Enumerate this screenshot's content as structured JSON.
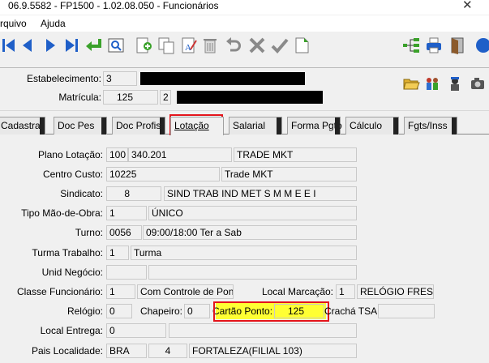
{
  "window": {
    "title": "06.9.5582 - FP1500 - 1.02.08.050 - Funcionários",
    "close_glyph": "✕"
  },
  "menu": {
    "items": [
      "Arquivo",
      "Ajuda"
    ]
  },
  "toolbar": {
    "icons": [
      "first-record-icon",
      "prev-record-icon",
      "next-record-icon",
      "last-record-icon",
      "confirm-return-icon",
      "search-record-icon",
      "new-record-icon",
      "copy-record-icon",
      "edit-record-icon",
      "delete-record-icon",
      "undo-icon",
      "cancel-icon",
      "save-check-icon",
      "note-icon",
      "tree-icon",
      "print-icon",
      "exit-door-icon",
      "help-icon"
    ],
    "colors": {
      "blue": "#1f5fc8",
      "green": "#3aa12a",
      "gray": "#8a8a8a"
    }
  },
  "header": {
    "estabelecimento_label": "Estabelecimento:",
    "estabelecimento_value": "3",
    "matricula_label": "Matrícula:",
    "matricula_value": "125",
    "matricula_digit": "2"
  },
  "tabs": [
    {
      "label": "Cadastral"
    },
    {
      "label": "Doc Pes"
    },
    {
      "label": "Doc Profis"
    },
    {
      "label": "Lotação"
    },
    {
      "label": "Salarial"
    },
    {
      "label": "Forma Pgto"
    },
    {
      "label": "Cálculo"
    },
    {
      "label": "Fgts/Inss"
    }
  ],
  "form": {
    "plano_lotacao": {
      "label": "Plano Lotação:",
      "code": "100",
      "value": "340.201",
      "desc": "TRADE MKT"
    },
    "centro_custo": {
      "label": "Centro Custo:",
      "code": "10225",
      "desc": "Trade MKT"
    },
    "sindicato": {
      "label": "Sindicato:",
      "code": "8",
      "desc": "SIND TRAB IND MET S M M E E I"
    },
    "tipo_mao_obra": {
      "label": "Tipo Mão-de-Obra:",
      "code": "1",
      "desc": "ÚNICO"
    },
    "turno": {
      "label": "Turno:",
      "code": "0056",
      "desc": "09:00/18:00 Ter a Sab"
    },
    "turma_trabalho": {
      "label": "Turma Trabalho:",
      "code": "1",
      "desc": "Turma"
    },
    "unid_negocio": {
      "label": "Unid Negócio:",
      "code": "",
      "desc": ""
    },
    "classe_funcionario": {
      "label": "Classe Funcionário:",
      "code": "1",
      "desc": "Com Controle de Ponto"
    },
    "local_marcacao": {
      "label": "Local Marcação:",
      "code": "1",
      "desc": "RELÓGIO FRESNI"
    },
    "relogio": {
      "label": "Relógio:",
      "value": "0"
    },
    "chapeiro": {
      "label": "Chapeiro:",
      "value": "0"
    },
    "cartao_ponto": {
      "label": "Cartão Ponto:",
      "value": "125"
    },
    "cracha_tsa": {
      "label": "Crachá TSA:",
      "value": ""
    },
    "local_entrega": {
      "label": "Local Entrega:",
      "code": "0",
      "desc": ""
    },
    "pais_localidade": {
      "label": "Pais Localidade:",
      "pais": "BRA",
      "code": "4",
      "desc": "FORTALEZA(FILIAL 103)"
    }
  },
  "highlight_colors": {
    "red": "#e4141b",
    "yellow": "#ffff33"
  }
}
